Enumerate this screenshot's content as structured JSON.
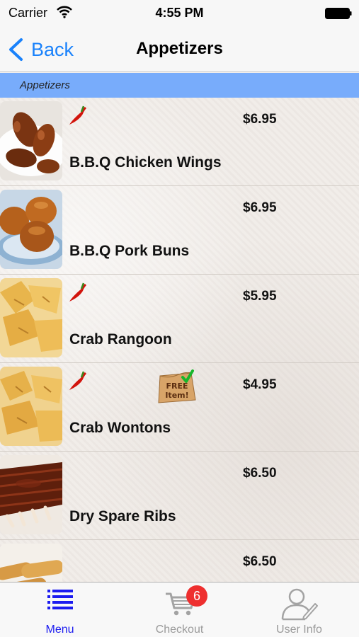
{
  "status_bar": {
    "carrier": "Carrier",
    "time": "4:55 PM"
  },
  "nav": {
    "back_label": "Back",
    "title": "Appetizers"
  },
  "section": {
    "header": "Appetizers"
  },
  "items": [
    {
      "name": "B.B.Q Chicken Wings",
      "price": "$6.95",
      "spicy": true,
      "free": false,
      "image": "chicken-wings"
    },
    {
      "name": "B.B.Q Pork Buns",
      "price": "$6.95",
      "spicy": false,
      "free": false,
      "image": "pork-buns"
    },
    {
      "name": "Crab Rangoon",
      "price": "$5.95",
      "spicy": true,
      "free": false,
      "image": "crab-rangoon"
    },
    {
      "name": "Crab Wontons",
      "price": "$4.95",
      "spicy": true,
      "free": true,
      "image": "crab-wontons"
    },
    {
      "name": "Dry Spare Ribs",
      "price": "$6.50",
      "spicy": false,
      "free": false,
      "image": "spare-ribs"
    },
    {
      "name": "",
      "price": "$6.50",
      "spicy": false,
      "free": false,
      "image": "egg-rolls"
    }
  ],
  "tab_bar": {
    "tabs": [
      {
        "label": "Menu",
        "icon": "list-icon",
        "active": true
      },
      {
        "label": "Checkout",
        "icon": "cart-icon",
        "active": false,
        "badge": "6"
      },
      {
        "label": "User Info",
        "icon": "user-icon",
        "active": false
      }
    ]
  },
  "colors": {
    "accent": "#1a82fb",
    "section_header": "#78acfb",
    "active_tab": "#1c1cf0",
    "badge": "#ee2f2f"
  }
}
